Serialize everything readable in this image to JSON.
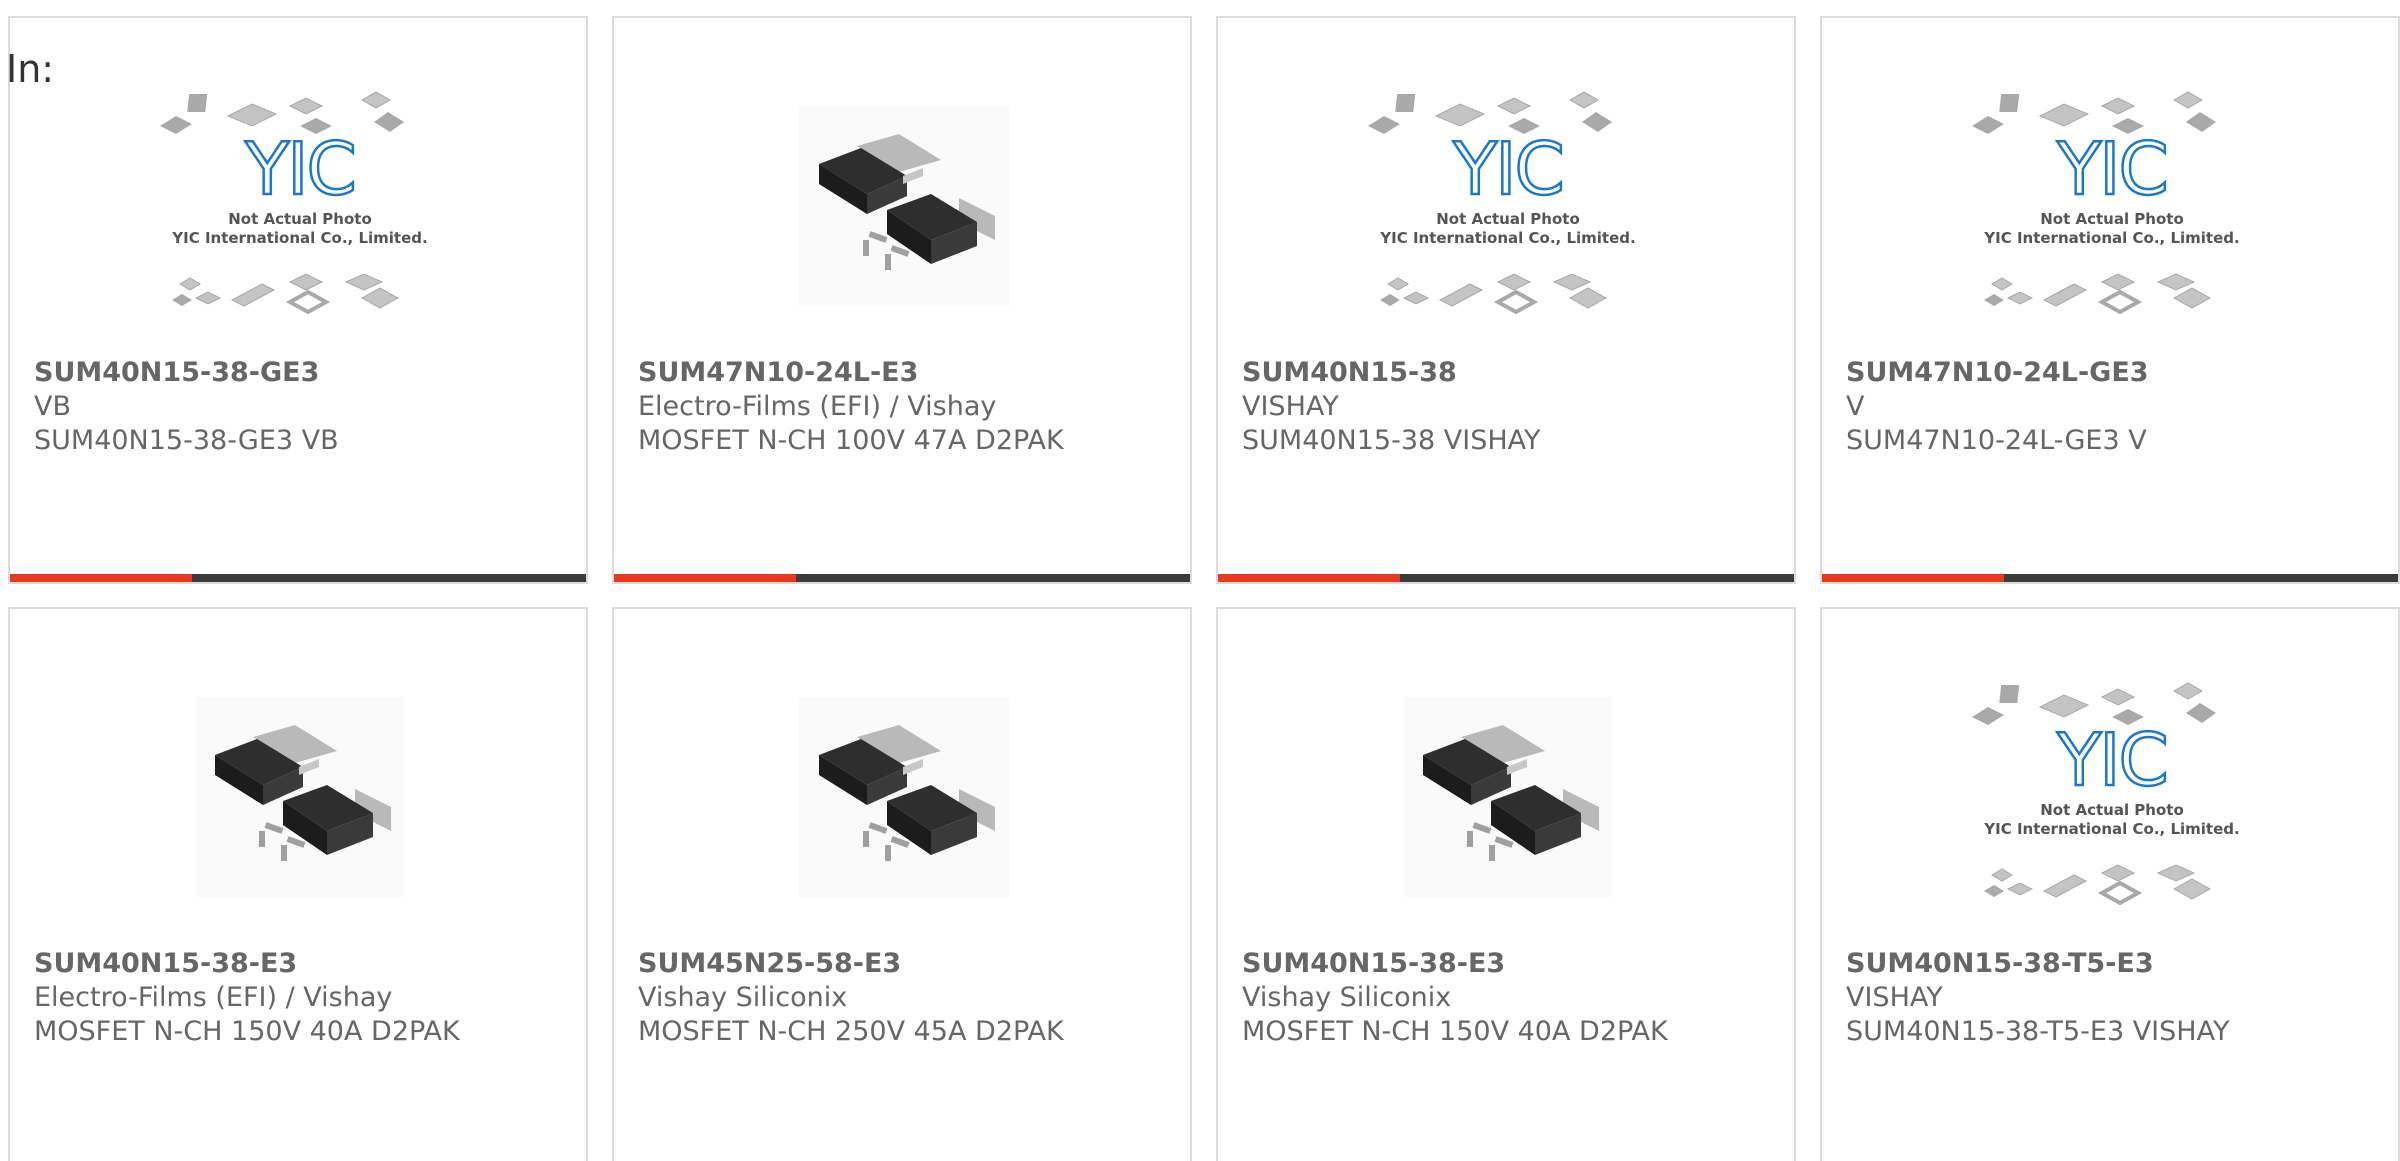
{
  "header": {
    "label": "In:"
  },
  "placeholder_image": {
    "line1": "Not Actual Photo",
    "line2": "YIC International Co., Limited.",
    "logo_text": "YIC"
  },
  "colors": {
    "accent": "#e83a1a",
    "bar": "#3b3b3b",
    "border": "#dcdcdc",
    "text": "#666666",
    "logo": "#1e78c8"
  },
  "products": [
    {
      "part": "SUM40N15-38-GE3",
      "maker": "VB",
      "desc": "SUM40N15-38-GE3 VB",
      "image": "yic-placeholder-icon"
    },
    {
      "part": "SUM47N10-24L-E3",
      "maker": "Electro-Films (EFI) / Vishay",
      "desc": "MOSFET N-CH 100V 47A D2PAK",
      "image": "d2pak-chip-icon"
    },
    {
      "part": "SUM40N15-38",
      "maker": "VISHAY",
      "desc": "SUM40N15-38 VISHAY",
      "image": "yic-placeholder-icon"
    },
    {
      "part": "SUM47N10-24L-GE3",
      "maker": "V",
      "desc": "SUM47N10-24L-GE3 V",
      "image": "yic-placeholder-icon"
    },
    {
      "part": "SUM40N15-38-E3",
      "maker": "Electro-Films (EFI) / Vishay",
      "desc": "MOSFET N-CH 150V 40A D2PAK",
      "image": "d2pak-chip-icon"
    },
    {
      "part": "SUM45N25-58-E3",
      "maker": "Vishay Siliconix",
      "desc": "MOSFET N-CH 250V 45A D2PAK",
      "image": "d2pak-chip-icon"
    },
    {
      "part": "SUM40N15-38-E3",
      "maker": "Vishay Siliconix",
      "desc": "MOSFET N-CH 150V 40A D2PAK",
      "image": "d2pak-chip-icon"
    },
    {
      "part": "SUM40N15-38-T5-E3",
      "maker": "VISHAY",
      "desc": "SUM40N15-38-T5-E3 VISHAY",
      "image": "yic-placeholder-icon"
    }
  ]
}
